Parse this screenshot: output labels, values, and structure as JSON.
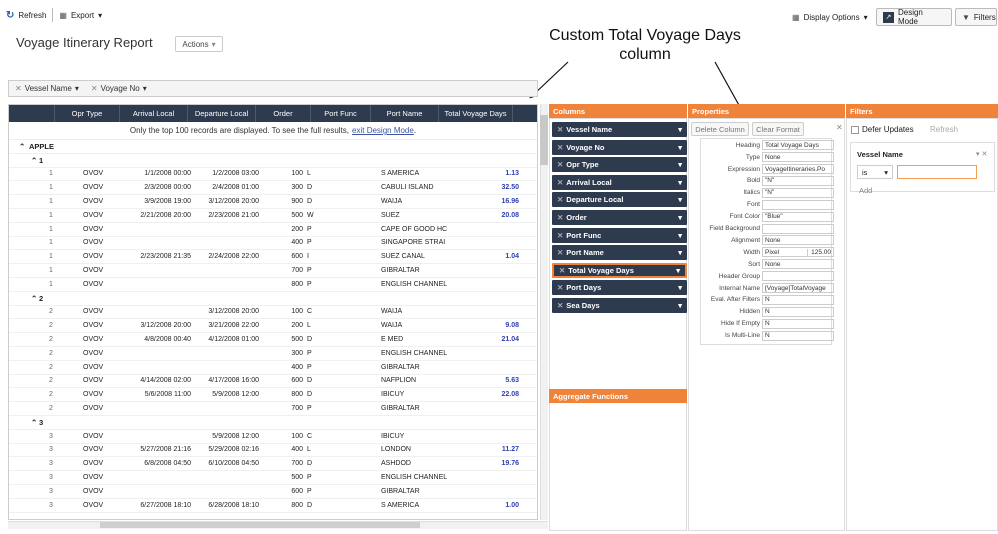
{
  "toolbar": {
    "refresh": "Refresh",
    "export": "Export",
    "display_options": "Display Options",
    "design_mode": "Design Mode",
    "filters": "Filters"
  },
  "title": "Voyage Itinerary Report",
  "actions": "Actions",
  "annotation": "Custom Total Voyage Days column",
  "group_by": [
    "Vessel Name",
    "Voyage No"
  ],
  "columns": [
    "Opr Type",
    "Arrival Local",
    "Departure Local",
    "Order",
    "Port Func",
    "Port Name",
    "Total Voyage Days"
  ],
  "notice": "Only the top 100 records are displayed. To see the full results,",
  "notice_link": "exit Design Mode",
  "notice_end": ".",
  "vessel_group": "APPLE",
  "voyages": [
    {
      "label": "1",
      "rows": [
        {
          "opr": "OVOV",
          "arr": "1/1/2008 00:00",
          "dep": "1/2/2008 03:00",
          "order": "100",
          "func": "L",
          "port": "S AMERICA",
          "days": "1.13"
        },
        {
          "opr": "OVOV",
          "arr": "2/3/2008 00:00",
          "dep": "2/4/2008 01:00",
          "order": "300",
          "func": "D",
          "port": "CABULI ISLAND",
          "days": "32.50"
        },
        {
          "opr": "OVOV",
          "arr": "3/9/2008 19:00",
          "dep": "3/12/2008 20:00",
          "order": "900",
          "func": "D",
          "port": "WAIJA",
          "days": "16.96"
        },
        {
          "opr": "OVOV",
          "arr": "2/21/2008 20:00",
          "dep": "2/23/2008 21:00",
          "order": "500",
          "func": "W",
          "port": "SUEZ",
          "days": "20.08"
        },
        {
          "opr": "OVOV",
          "arr": "",
          "dep": "",
          "order": "200",
          "func": "P",
          "port": "CAPE OF GOOD HC",
          "days": ""
        },
        {
          "opr": "OVOV",
          "arr": "",
          "dep": "",
          "order": "400",
          "func": "P",
          "port": "SINGAPORE STRAI",
          "days": ""
        },
        {
          "opr": "OVOV",
          "arr": "2/23/2008 21:35",
          "dep": "2/24/2008 22:00",
          "order": "600",
          "func": "I",
          "port": "SUEZ CANAL",
          "days": "1.04"
        },
        {
          "opr": "OVOV",
          "arr": "",
          "dep": "",
          "order": "700",
          "func": "P",
          "port": "GIBRALTAR",
          "days": ""
        },
        {
          "opr": "OVOV",
          "arr": "",
          "dep": "",
          "order": "800",
          "func": "P",
          "port": "ENGLISH CHANNEL",
          "days": ""
        }
      ]
    },
    {
      "label": "2",
      "rows": [
        {
          "opr": "OVOV",
          "arr": "",
          "dep": "3/12/2008 20:00",
          "order": "100",
          "func": "C",
          "port": "WAIJA",
          "days": ""
        },
        {
          "opr": "OVOV",
          "arr": "3/12/2008 20:00",
          "dep": "3/21/2008 22:00",
          "order": "200",
          "func": "L",
          "port": "WAIJA",
          "days": "9.08"
        },
        {
          "opr": "OVOV",
          "arr": "4/8/2008 00:40",
          "dep": "4/12/2008 01:00",
          "order": "500",
          "func": "D",
          "port": "E MED",
          "days": "21.04"
        },
        {
          "opr": "OVOV",
          "arr": "",
          "dep": "",
          "order": "300",
          "func": "P",
          "port": "ENGLISH CHANNEL",
          "days": ""
        },
        {
          "opr": "OVOV",
          "arr": "",
          "dep": "",
          "order": "400",
          "func": "P",
          "port": "GIBRALTAR",
          "days": ""
        },
        {
          "opr": "OVOV",
          "arr": "4/14/2008 02:00",
          "dep": "4/17/2008 16:00",
          "order": "600",
          "func": "D",
          "port": "NAFPLION",
          "days": "5.63"
        },
        {
          "opr": "OVOV",
          "arr": "5/6/2008 11:00",
          "dep": "5/9/2008 12:00",
          "order": "800",
          "func": "D",
          "port": "IBICUY",
          "days": "22.08"
        },
        {
          "opr": "OVOV",
          "arr": "",
          "dep": "",
          "order": "700",
          "func": "P",
          "port": "GIBRALTAR",
          "days": ""
        }
      ]
    },
    {
      "label": "3",
      "rows": [
        {
          "opr": "OVOV",
          "arr": "",
          "dep": "5/9/2008 12:00",
          "order": "100",
          "func": "C",
          "port": "IBICUY",
          "days": ""
        },
        {
          "opr": "OVOV",
          "arr": "5/27/2008 21:16",
          "dep": "5/29/2008 02:16",
          "order": "400",
          "func": "L",
          "port": "LONDON",
          "days": "11.27"
        },
        {
          "opr": "OVOV",
          "arr": "6/8/2008 04:50",
          "dep": "6/10/2008 04:50",
          "order": "700",
          "func": "D",
          "port": "ASHDOD",
          "days": "19.76"
        },
        {
          "opr": "OVOV",
          "arr": "",
          "dep": "",
          "order": "500",
          "func": "P",
          "port": "ENGLISH CHANNEL",
          "days": ""
        },
        {
          "opr": "OVOV",
          "arr": "",
          "dep": "",
          "order": "600",
          "func": "P",
          "port": "GIBRALTAR",
          "days": ""
        },
        {
          "opr": "OVOV",
          "arr": "6/27/2008 18:10",
          "dep": "6/28/2008 18:10",
          "order": "800",
          "func": "D",
          "port": "S AMERICA",
          "days": "1.00"
        }
      ]
    }
  ],
  "columns_panel": {
    "title": "Columns",
    "items": [
      "Vessel Name",
      "Voyage No",
      "Opr Type",
      "Arrival Local",
      "Departure Local",
      "Order",
      "Port Func",
      "Port Name",
      "Total Voyage Days",
      "Port Days",
      "Sea Days"
    ],
    "aggregate": "Aggregate Functions"
  },
  "properties_panel": {
    "title": "Properties",
    "delete_column": "Delete Column",
    "clear_format": "Clear Format",
    "rows": [
      {
        "k": "Heading",
        "v": "Total Voyage Days"
      },
      {
        "k": "Type",
        "v": "None"
      },
      {
        "k": "Expression",
        "v": "VoyageItineraries.Po"
      },
      {
        "k": "Bold",
        "v": "\"N\""
      },
      {
        "k": "Italics",
        "v": "\"N\""
      },
      {
        "k": "Font",
        "v": ""
      },
      {
        "k": "Font Color",
        "v": "\"Blue\""
      },
      {
        "k": "Field Background",
        "v": ""
      },
      {
        "k": "Alignment",
        "v": "None"
      },
      {
        "k": "Width",
        "v": "Pixel"
      },
      {
        "k": "Sort",
        "v": "None"
      },
      {
        "k": "Header Group",
        "v": ""
      },
      {
        "k": "Internal Name",
        "v": "[Voyage]TotalVoyage"
      },
      {
        "k": "Eval. After Filters",
        "v": "N"
      },
      {
        "k": "Hidden",
        "v": "N"
      },
      {
        "k": "Hide If Empty",
        "v": "N"
      },
      {
        "k": "Is Multi-Line",
        "v": "N"
      }
    ],
    "width_value": "125.00"
  },
  "filters_panel": {
    "title": "Filters",
    "defer": "Defer Updates",
    "refresh": "Refresh",
    "field": "Vessel Name",
    "op": "is",
    "add": "Add"
  }
}
